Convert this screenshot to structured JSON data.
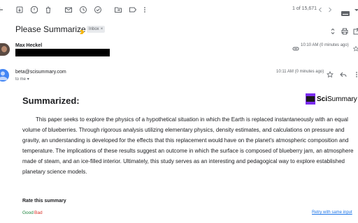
{
  "toolbar": {
    "pager": "1 of 15,671",
    "icons": [
      "back-arrow-icon",
      "archive-icon",
      "report-spam-icon",
      "delete-icon",
      "mark-unread-icon",
      "snooze-icon",
      "add-task-icon",
      "move-to-icon",
      "label-icon",
      "more-vert-icon",
      "chevron-left-icon",
      "chevron-right-icon",
      "keyboard-icon"
    ]
  },
  "email": {
    "subject": "Please Summarize",
    "label_chip": "Inbox",
    "chip_close": "×"
  },
  "message1": {
    "sender": "Max Heckel",
    "time": "10:10 AM (0 minutes ago)"
  },
  "message2": {
    "sender": "beta@scisummary.com",
    "to": "to me",
    "time": "10:11 AM (0 minutes ago)"
  },
  "content": {
    "heading": "Summarized:",
    "logo_bold": "Sci",
    "logo_rest": "Summary",
    "summary": "This paper seeks to explore the physics of a hypothetical situation in which the Earth is replaced instantaneously with an equal volume of blueberries. Through rigorous analysis utilizing elementary physics, density estimates, and calculations on pressure and gravity, an understanding is developed for the effects that this replacement would have on the planet's atmospheric composition and temperature. The implications of these results suggest an outcome in which the surface is composed of blueberry jam, an atmosphere made of steam, and an ice-filled interior. Ultimately, this study serves as an interesting and pedagogical way to explore established planetary science models.",
    "rate_label": "Rate this summary",
    "good": "Good",
    "bad": "Bad",
    "retry": "Retry with same input"
  },
  "colors": {
    "brand": "#7b2cf0",
    "good": "#188038",
    "bad": "#d93025",
    "link": "#1a73e8",
    "importance_marker": "#f4b400"
  }
}
